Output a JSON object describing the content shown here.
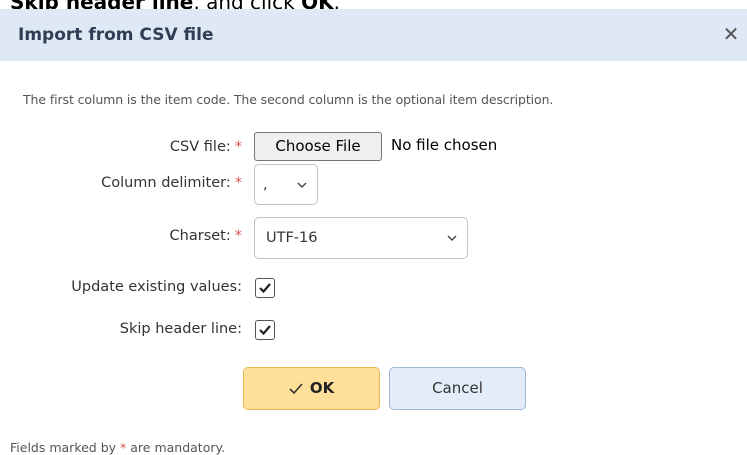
{
  "instruction": {
    "prefix": "Skip header line",
    "suffix": ", and click ",
    "action": "OK",
    "end": "."
  },
  "dialog": {
    "title": "Import from CSV file",
    "close_icon": "close-icon",
    "hint": "The first column is the item code. The second column is the optional item description.",
    "required_marker": "*",
    "csv_file": {
      "label": "CSV file:",
      "button_label": "Choose File",
      "status": "No file chosen"
    },
    "delimiter": {
      "label": "Column delimiter:",
      "value": ","
    },
    "charset": {
      "label": "Charset:",
      "value": "UTF-16"
    },
    "update_existing": {
      "label": "Update existing values:",
      "checked": true
    },
    "skip_header": {
      "label": "Skip header line:",
      "checked": true
    },
    "ok_label": "OK",
    "cancel_label": "Cancel",
    "footer": {
      "prefix": "Fields marked by",
      "marker": "*",
      "suffix": "are mandatory."
    }
  },
  "colors": {
    "titlebar": "#dfe9f5",
    "ok_button": "#ffe09a",
    "cancel_button": "#e3edf9",
    "required": "#d9534f"
  }
}
